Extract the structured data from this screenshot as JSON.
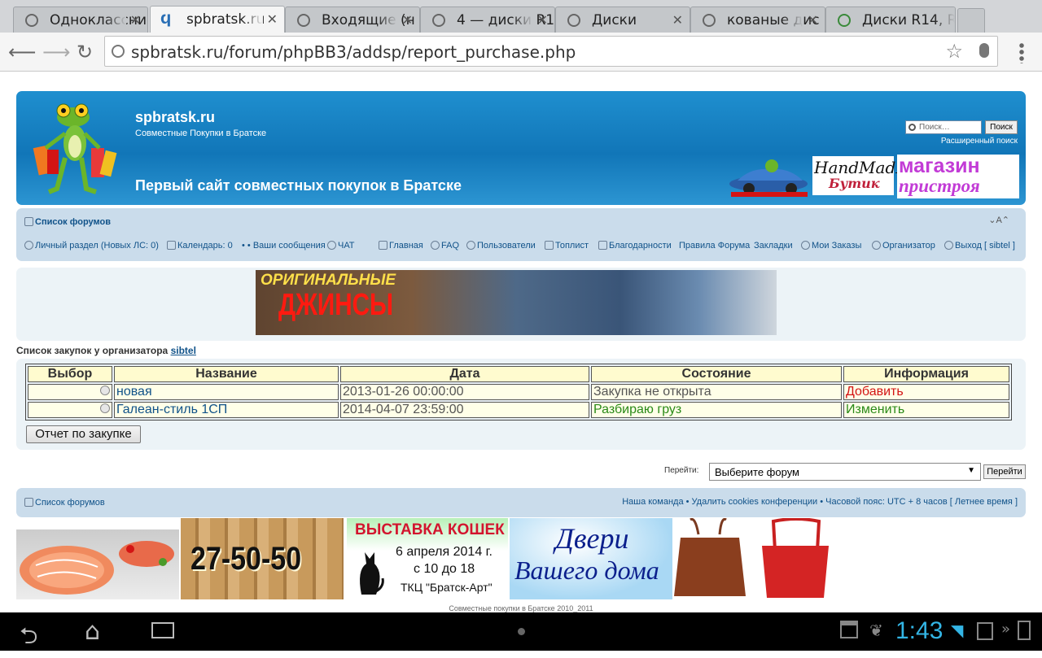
{
  "browser": {
    "tabs": [
      {
        "title": "Одноклассни",
        "icon": "globe-icon"
      },
      {
        "title": "spbratsk.ru",
        "icon": "phpbb-icon",
        "active": true
      },
      {
        "title": "Входящие (н",
        "icon": "globe-icon"
      },
      {
        "title": "4 — диски R1",
        "icon": "globe-icon"
      },
      {
        "title": "Диски",
        "icon": "globe-icon"
      },
      {
        "title": "кованые дис",
        "icon": "globe-icon"
      },
      {
        "title": "Диски R14, R",
        "icon": "colorful-icon"
      }
    ],
    "url": "spbratsk.ru/forum/phpBB3/addsp/report_purchase.php"
  },
  "header": {
    "site_name": "spbratsk.ru",
    "site_desc": "Совместные Покупки в Братске",
    "tagline": "Первый сайт совместных покупок в Братске",
    "search_placeholder": "Поиск…",
    "search_button": "Поиск",
    "advanced_search": "Расширенный поиск",
    "logo2_line1": "HandMadE",
    "logo2_line2": "Бутик",
    "logo3_line1": "магазин",
    "logo3_line2": "пристроя"
  },
  "navbar": {
    "forum_index": "Список форумов",
    "font_size": "A",
    "links": {
      "private": "Личный раздел (Новых ЛС: 0)",
      "calendar": "Календарь: 0",
      "messages": "• • Ваши сообщения",
      "chat": "ЧАТ",
      "home": "Главная",
      "faq": "FAQ",
      "users": "Пользователи",
      "top": "Топлист",
      "thanks": "Благодарности",
      "rules": "Правила Форума",
      "bookmarks": "Закладки",
      "orders": "Мои Заказы",
      "organizer": "Организатор",
      "logout": "Выход [ sibtel ]"
    }
  },
  "banner": {
    "line1": "ОРИГИНАЛЬНЫЕ",
    "line2": "ДЖИНСЫ"
  },
  "purchases": {
    "title_prefix": "Список закупок у организатора",
    "organizer": "sibtel",
    "headers": [
      "Выбор",
      "Название",
      "Дата",
      "Состояние",
      "Информация"
    ],
    "rows": [
      {
        "name": "новая",
        "date": "2013-01-26 00:00:00",
        "status": "Закупка не открыта",
        "info": "Добавить",
        "status_color": "#555555",
        "info_color": "#d31414"
      },
      {
        "name": "Галеан-стиль 1СП",
        "date": "2014-04-07 23:59:00",
        "status": "Разбираю груз",
        "info": "Изменить",
        "status_color": "#2a8a18",
        "info_color": "#2a8a18"
      }
    ],
    "report_button": "Отчет по закупке"
  },
  "jump": {
    "label": "Перейти:",
    "selected": "Выберите форум",
    "button": "Перейти"
  },
  "footer": {
    "forum_index": "Список форумов",
    "links": "Наша команда • Удалить cookies конференции • Часовой пояс: UTC + 8 часов [ Летнее время ]",
    "copyright": "Совместные покупки в Братске 2010_2011"
  },
  "ads": {
    "phone": "27-50-50",
    "cats_title": "ВЫСТАВКА КОШЕК",
    "cats_date": "6 апреля 2014 г.",
    "cats_time": "с 10 до 18",
    "cats_place": "ТКЦ \"Братск-Арт\"",
    "doors_1": "Двери",
    "doors_2": "Вашего дома"
  },
  "system": {
    "clock": "1:43"
  }
}
